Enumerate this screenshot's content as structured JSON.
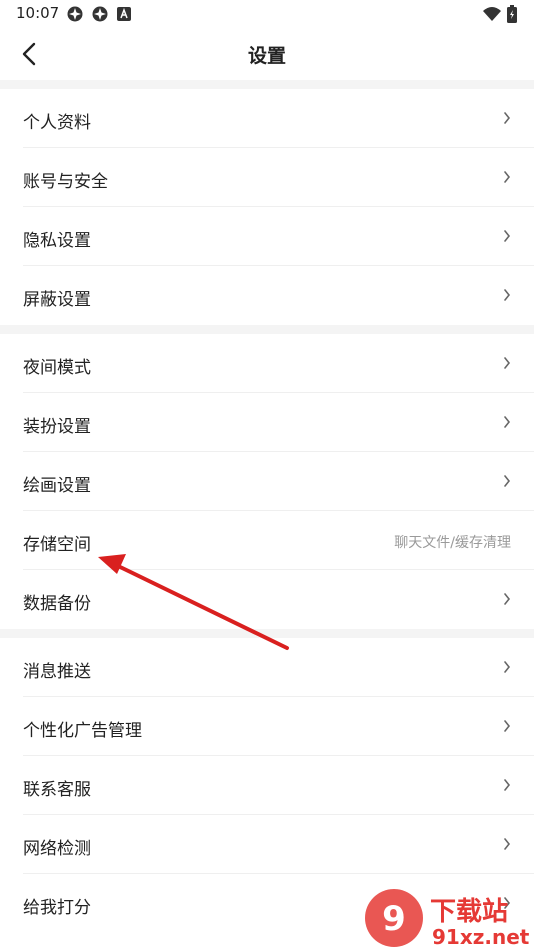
{
  "status": {
    "time": "10:07",
    "left_icons": [
      "app-icon",
      "app-icon",
      "a-notification-icon"
    ],
    "right_icons": [
      "wifi-icon",
      "battery-icon"
    ]
  },
  "header": {
    "title": "设置"
  },
  "groups": [
    {
      "items": [
        {
          "label": "个人资料"
        },
        {
          "label": "账号与安全"
        },
        {
          "label": "隐私设置"
        },
        {
          "label": "屏蔽设置"
        }
      ]
    },
    {
      "items": [
        {
          "label": "夜间模式"
        },
        {
          "label": "装扮设置"
        },
        {
          "label": "绘画设置"
        },
        {
          "label": "存储空间",
          "hint": "聊天文件/缓存清理"
        },
        {
          "label": "数据备份"
        }
      ]
    },
    {
      "items": [
        {
          "label": "消息推送"
        },
        {
          "label": "个性化广告管理"
        },
        {
          "label": "联系客服"
        },
        {
          "label": "网络检测"
        },
        {
          "label": "给我打分"
        }
      ]
    }
  ],
  "annotation": {
    "color": "#d9201f"
  },
  "watermark": {
    "logo_text": "9下载站",
    "url": "91xz.net"
  }
}
